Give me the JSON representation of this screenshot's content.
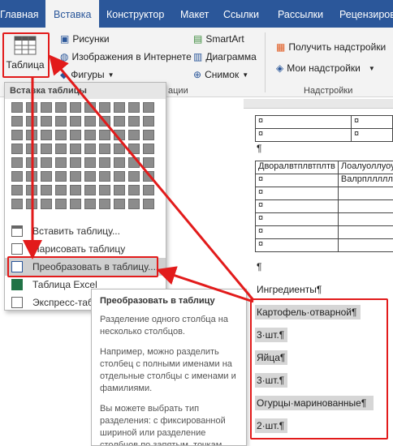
{
  "tabs": [
    "Главная",
    "Вставка",
    "Конструктор",
    "Макет",
    "Ссылки",
    "Рассылки",
    "Рецензирова"
  ],
  "active_tab": "Вставка",
  "ribbon": {
    "table_button": "Таблица",
    "pictures": "Рисунки",
    "online_images": "Изображения в Интернете",
    "shapes": "Фигуры",
    "smartart": "SmartArt",
    "chart": "Диаграмма",
    "screenshot": "Снимок",
    "get_addins": "Получить надстройки",
    "my_addins": "Мои надстройки",
    "group_addins": "Надстройки",
    "group_illustrations_tail": "ации"
  },
  "dropdown": {
    "header": "Вставка таблицы",
    "grid_cols": 10,
    "grid_rows": 8,
    "items": [
      {
        "label": "Вставить таблицу...",
        "selected": false
      },
      {
        "label": "Нарисовать таблицу",
        "selected": false
      },
      {
        "label": "Преобразовать в таблицу...",
        "selected": true
      },
      {
        "label": "Таблица Excel",
        "selected": false
      },
      {
        "label": "Экспресс-табл",
        "selected": false
      }
    ]
  },
  "tooltip": {
    "title": "Преобразовать в таблицу",
    "p1": "Разделение одного столбца на несколько столбцов.",
    "p2": "Например, можно разделить столбец с полными именами на отдельные столбцы с именами и фамилиями.",
    "p3": "Вы можете выбрать тип разделения: с фиксированной шириной или разделение столбцов по запятым, точкам"
  },
  "document": {
    "cell_mark": "¤",
    "para_mark": "¶",
    "table2_h1": "Дворалвтплвтплтв",
    "table2_h2": "Лоалуоллуоу",
    "table2_r1c2": "Валрпллллл",
    "ingredients_title": "Ингредиенты¶",
    "lines": [
      "Картофель·отварной¶",
      "3·шт.¶",
      "Яйца¶",
      "3·шт.¶",
      "Огурцы·маринованные¶",
      "2·шт.¶"
    ]
  },
  "colors": {
    "accent": "#2b579a",
    "annotation": "#e21b1b"
  }
}
